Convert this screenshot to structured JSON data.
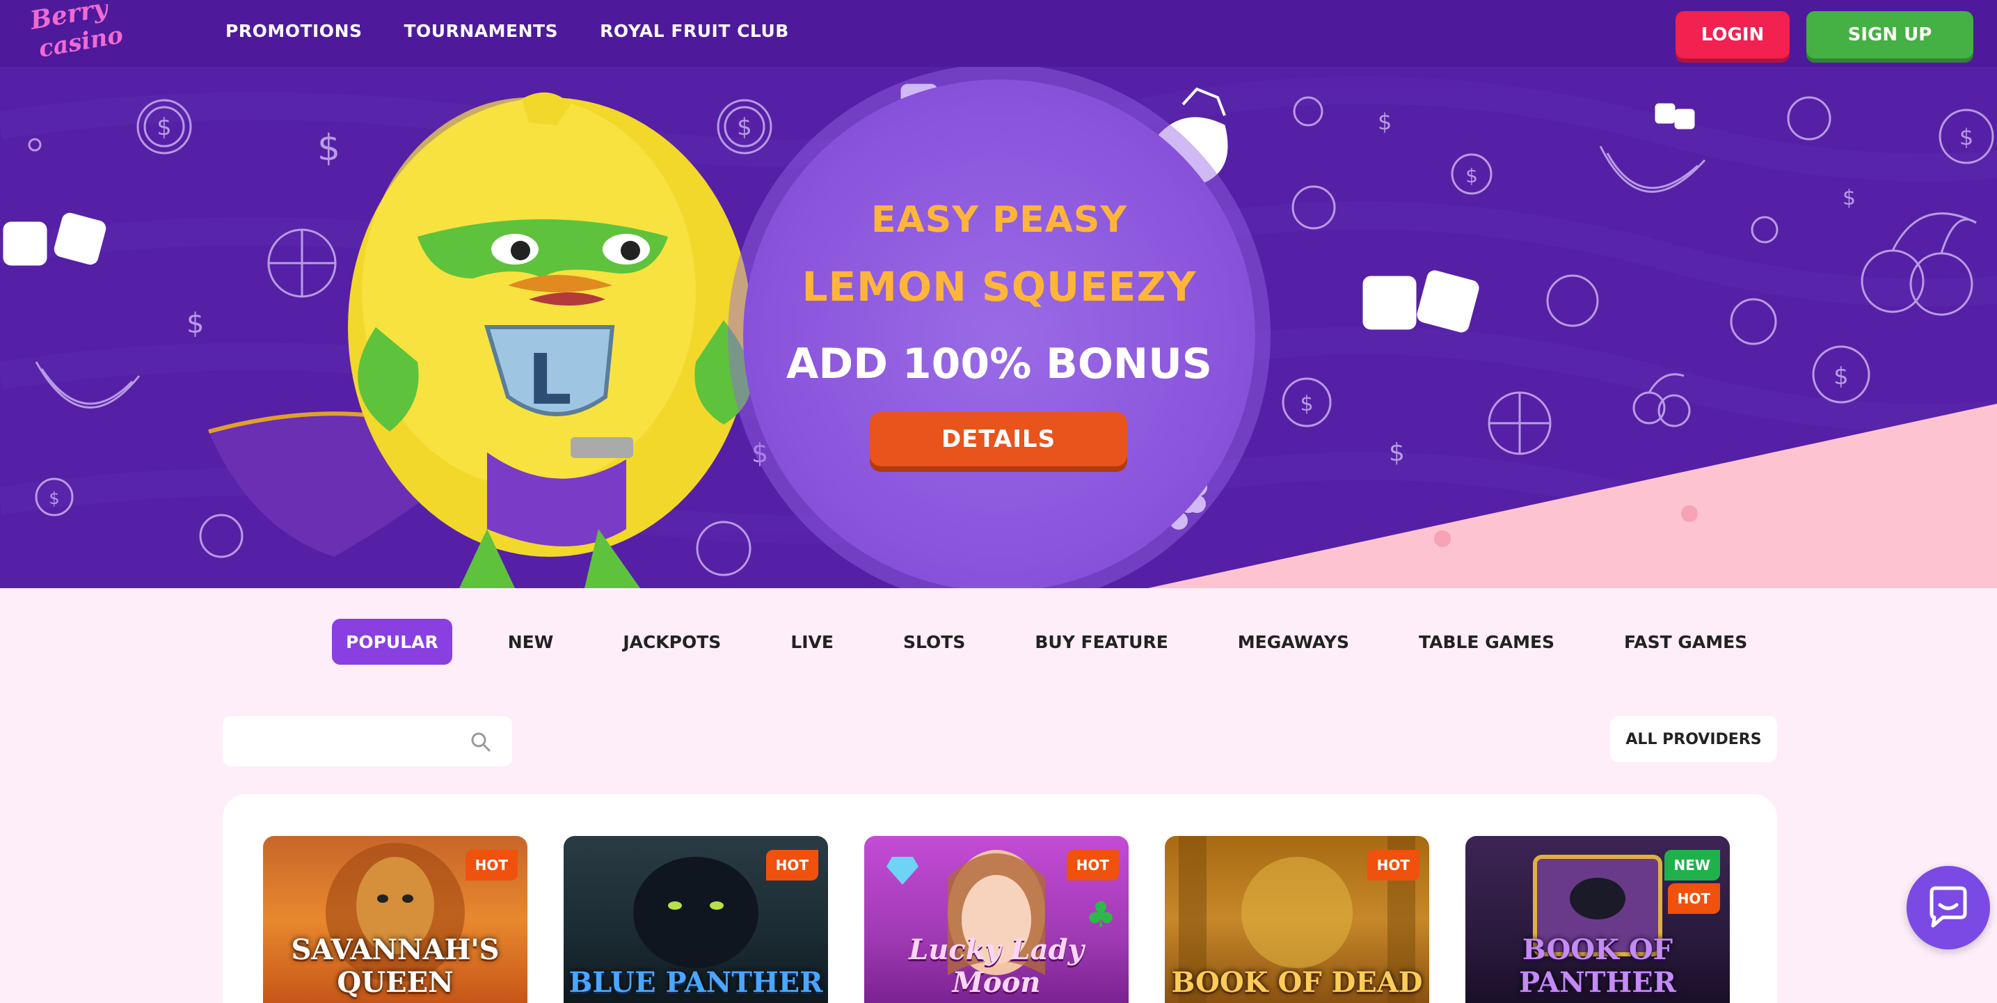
{
  "header": {
    "logo_text": "Berry casino",
    "nav": [
      "PROMOTIONS",
      "TOURNAMENTS",
      "ROYAL FRUIT CLUB"
    ],
    "login_label": "LOGIN",
    "signup_label": "SIGN UP"
  },
  "hero": {
    "line1": "EASY PEASY",
    "line2": "LEMON SQUEEZY",
    "line3": "ADD 100% BONUS",
    "details_label": "DETAILS"
  },
  "tabs": [
    "POPULAR",
    "NEW",
    "JACKPOTS",
    "LIVE",
    "SLOTS",
    "BUY FEATURE",
    "MEGAWAYS",
    "TABLE GAMES",
    "FAST GAMES"
  ],
  "active_tab": "POPULAR",
  "search": {
    "placeholder": ""
  },
  "providers_label": "ALL PROVIDERS",
  "games": [
    {
      "title": "SAVANNAH'S QUEEN",
      "badges": [
        "HOT"
      ]
    },
    {
      "title": "BLUE PANTHER",
      "badges": [
        "HOT"
      ]
    },
    {
      "title": "Lucky Lady Moon",
      "badges": [
        "HOT"
      ]
    },
    {
      "title": "BOOK OF DEAD",
      "badges": [
        "HOT"
      ]
    },
    {
      "title": "BOOK OF PANTHER",
      "badges": [
        "NEW",
        "HOT"
      ]
    }
  ],
  "colors": {
    "header_bg": "#4e1a9b",
    "hero_bg": "#5520a5",
    "accent_purple": "#8a3fe0",
    "login": "#f2214f",
    "signup": "#45b043",
    "details": "#e8541b",
    "promo_yellow": "#ffb53a",
    "hot_badge": "#f0510d",
    "new_badge": "#1fb14c"
  },
  "icons": [
    "search-icon",
    "chat-icon",
    "dice-icon",
    "dollar-coin-icon",
    "strawberry-icon",
    "cherry-icon",
    "banana-icon",
    "lemon-mascot"
  ]
}
